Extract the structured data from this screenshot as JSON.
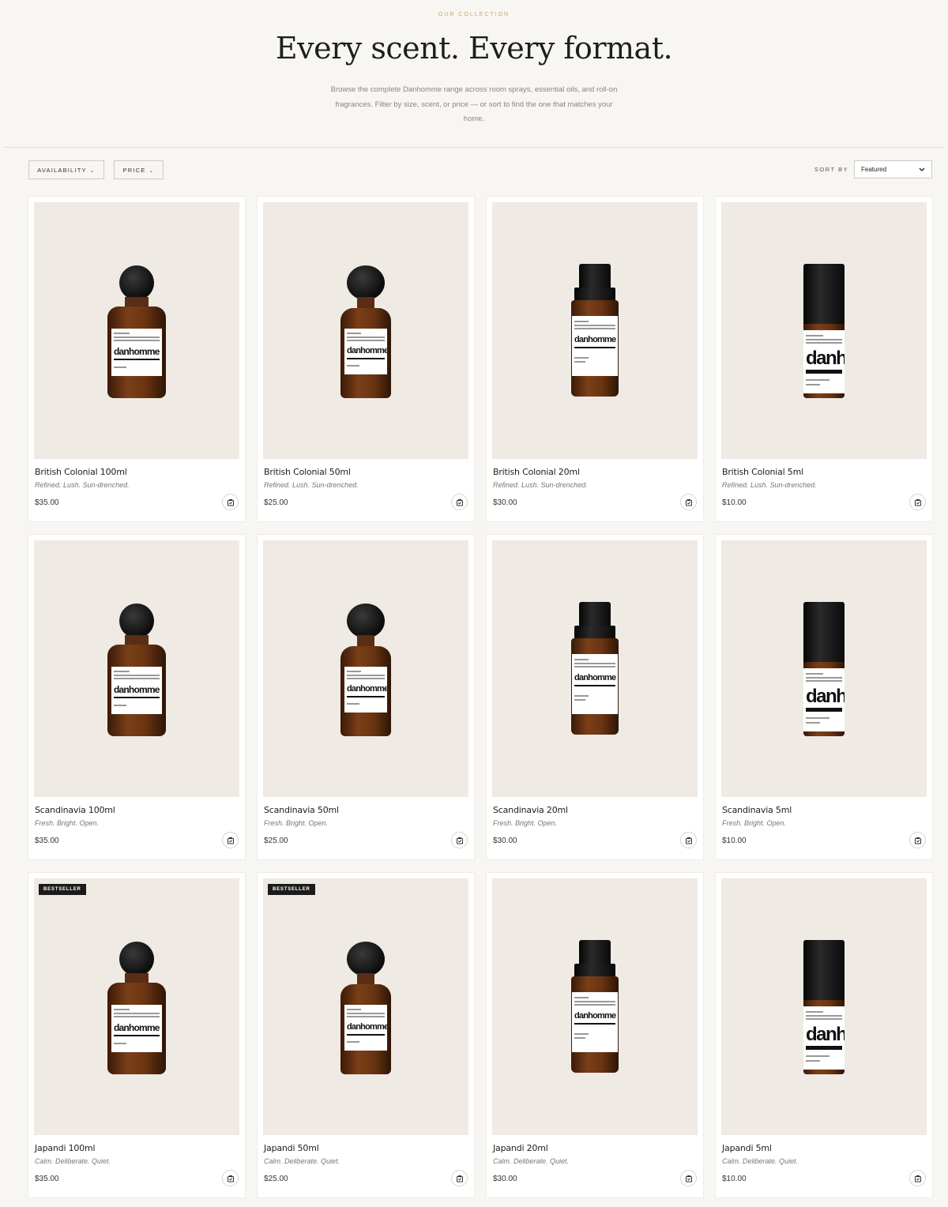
{
  "hero": {
    "eyebrow": "OUR COLLECTION",
    "title": "Every scent. Every format.",
    "subtitle": "Browse the complete Danhomme range across room sprays, essential oils, and roll-on fragrances. Filter by size, scent, or price — or sort to find the one that matches your home."
  },
  "filters": {
    "availability_label": "AVAILABILITY",
    "price_label": "PRICE",
    "sort_label": "SORT BY",
    "sort_value": "Featured"
  },
  "products": [
    {
      "name": "British Colonial 100ml",
      "desc": "Refined. Lush. Sun-drenched.",
      "price": "$35.00",
      "badge": "",
      "format": "big",
      "brand": "danhomme"
    },
    {
      "name": "British Colonial 50ml",
      "desc": "Refined. Lush. Sun-drenched.",
      "price": "$25.00",
      "badge": "",
      "format": "mid",
      "brand": "danhomme"
    },
    {
      "name": "British Colonial 20ml",
      "desc": "Refined. Lush. Sun-drenched.",
      "price": "$30.00",
      "badge": "",
      "format": "drop",
      "brand": "danhomme"
    },
    {
      "name": "British Colonial 5ml",
      "desc": "Refined. Lush. Sun-drenched.",
      "price": "$10.00",
      "badge": "",
      "format": "roll",
      "brand": "danh"
    },
    {
      "name": "Scandinavia 100ml",
      "desc": "Fresh. Bright. Open.",
      "price": "$35.00",
      "badge": "",
      "format": "big",
      "brand": "danhomme"
    },
    {
      "name": "Scandinavia 50ml",
      "desc": "Fresh. Bright. Open.",
      "price": "$25.00",
      "badge": "",
      "format": "mid",
      "brand": "danhomme"
    },
    {
      "name": "Scandinavia 20ml",
      "desc": "Fresh. Bright. Open.",
      "price": "$30.00",
      "badge": "",
      "format": "drop",
      "brand": "danhomme"
    },
    {
      "name": "Scandinavia 5ml",
      "desc": "Fresh. Bright. Open.",
      "price": "$10.00",
      "badge": "",
      "format": "roll",
      "brand": "danh"
    },
    {
      "name": "Japandi 100ml",
      "desc": "Calm. Deliberate. Quiet.",
      "price": "$35.00",
      "badge": "BESTSELLER",
      "format": "big",
      "brand": "danhomme"
    },
    {
      "name": "Japandi 50ml",
      "desc": "Calm. Deliberate. Quiet.",
      "price": "$25.00",
      "badge": "BESTSELLER",
      "format": "mid",
      "brand": "danhomme"
    },
    {
      "name": "Japandi 20ml",
      "desc": "Calm. Deliberate. Quiet.",
      "price": "$30.00",
      "badge": "",
      "format": "drop",
      "brand": "danhomme"
    },
    {
      "name": "Japandi 5ml",
      "desc": "Calm. Deliberate. Quiet.",
      "price": "$10.00",
      "badge": "",
      "format": "roll",
      "brand": "danh"
    }
  ],
  "colors": {
    "background": "#f8f6f2",
    "eyebrow": "#c9a36a",
    "badge": "#1b1b1b",
    "image_bg": "#efeae4"
  },
  "icons": {
    "cart": "add-to-cart-icon",
    "chevron": "chevron-down-icon"
  }
}
